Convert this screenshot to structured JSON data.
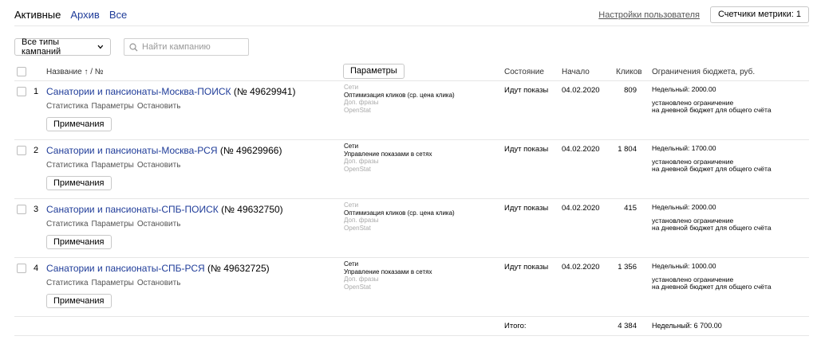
{
  "tabs": [
    {
      "label": "Активные",
      "active": true
    },
    {
      "label": "Архив",
      "active": false
    },
    {
      "label": "Все",
      "active": false
    }
  ],
  "header": {
    "settings_link": "Настройки пользователя",
    "metrics_button": "Счетчики метрики: 1"
  },
  "filters": {
    "campaign_type": "Все типы кампаний",
    "search_placeholder": "Найти кампанию"
  },
  "table": {
    "columns": {
      "name": "Название ↑ / №",
      "params_button": "Параметры",
      "state": "Состояние",
      "start": "Начало",
      "clicks": "Кликов",
      "budget": "Ограничения бюджета, руб."
    },
    "rows": [
      {
        "num": "1",
        "name": "Санатории и пансионаты-Москва-ПОИСК",
        "id": "(№ 49629941)",
        "link_stats": "Статистика",
        "link_params": "Параметры",
        "link_stop": "Остановить",
        "notes": "Примечания",
        "p1": "Сети",
        "p2": "Оптимизация кликов (ср. цена клика)",
        "p3": "Доп. фразы",
        "p4": "OpenStat",
        "state": "Идут показы",
        "start": "04.02.2020",
        "clicks": "809",
        "weekly": "Недельный: 2000.00",
        "lim1": "установлено ограничение",
        "lim2": "на дневной бюджет для общего счёта"
      },
      {
        "num": "2",
        "name": "Санатории и пансионаты-Москва-РСЯ",
        "id": "(№ 49629966)",
        "link_stats": "Статистика",
        "link_params": "Параметры",
        "link_stop": "Остановить",
        "notes": "Примечания",
        "p1": "Сети",
        "p2": "Управление показами в сетях",
        "p3": "Доп. фразы",
        "p4": "OpenStat",
        "state": "Идут показы",
        "start": "04.02.2020",
        "clicks": "1 804",
        "weekly": "Недельный: 1700.00",
        "lim1": "установлено ограничение",
        "lim2": "на дневной бюджет для общего счёта"
      },
      {
        "num": "3",
        "name": "Санатории и пансионаты-СПБ-ПОИСК",
        "id": "(№ 49632750)",
        "link_stats": "Статистика",
        "link_params": "Параметры",
        "link_stop": "Остановить",
        "notes": "Примечания",
        "p1": "Сети",
        "p2": "Оптимизация кликов (ср. цена клика)",
        "p3": "Доп. фразы",
        "p4": "OpenStat",
        "state": "Идут показы",
        "start": "04.02.2020",
        "clicks": "415",
        "weekly": "Недельный: 2000.00",
        "lim1": "установлено ограничение",
        "lim2": "на дневной бюджет для общего счёта"
      },
      {
        "num": "4",
        "name": "Санатории и пансионаты-СПБ-РСЯ",
        "id": "(№ 49632725)",
        "link_stats": "Статистика",
        "link_params": "Параметры",
        "link_stop": "Остановить",
        "notes": "Примечания",
        "p1": "Сети",
        "p2": "Управление показами в сетях",
        "p3": "Доп. фразы",
        "p4": "OpenStat",
        "state": "Идут показы",
        "start": "04.02.2020",
        "clicks": "1 356",
        "weekly": "Недельный: 1000.00",
        "lim1": "установлено ограничение",
        "lim2": "на дневной бюджет для общего счёта"
      }
    ],
    "total": {
      "label": "Итого:",
      "clicks": "4 384",
      "budget": "Недельный: 6 700.00"
    }
  },
  "colors": {
    "link": "#1f3c99",
    "muted": "#aaaaaa",
    "border": "#e6e6e6"
  }
}
